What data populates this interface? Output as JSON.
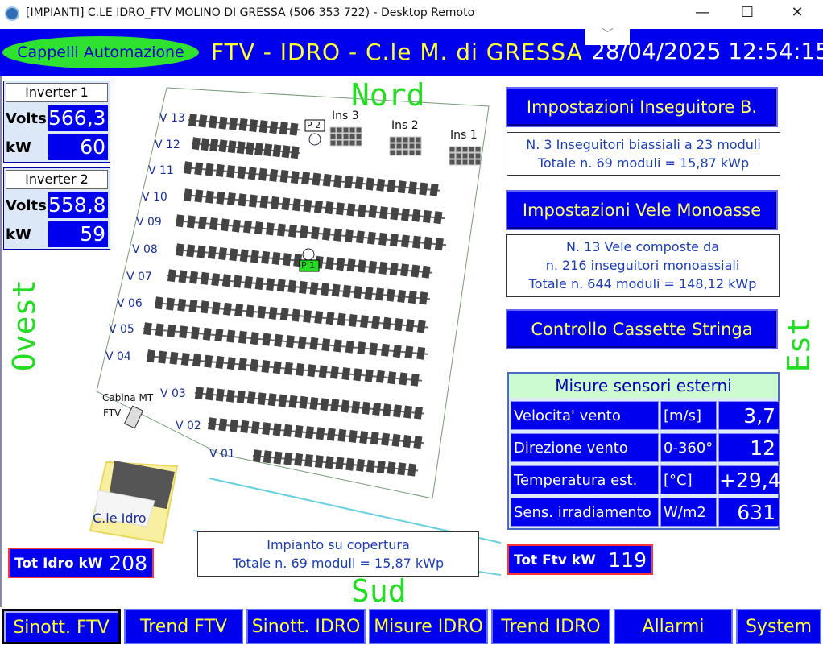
{
  "window": {
    "title": "[IMPIANTI] C.LE IDRO_FTV MOLINO DI GRESSA (506 353 722) - Desktop Remoto",
    "minimize": "—",
    "maximize": "☐",
    "close": "✕"
  },
  "header": {
    "brand": "Cappelli Automazione",
    "title": "FTV - IDRO - C.le M. di GRESSA",
    "datetime": "28/04/2025 12:54:15",
    "caret": "﹀"
  },
  "inverters": [
    {
      "title": "Inverter 1",
      "volts_label": "Volts",
      "volts": "566,3",
      "kw_label": "kW",
      "kw": "60"
    },
    {
      "title": "Inverter 2",
      "volts_label": "Volts",
      "volts": "558,8",
      "kw_label": "kW",
      "kw": "59"
    }
  ],
  "compass": {
    "north": "Nord",
    "south": "Sud",
    "west": "Ovest",
    "east": "Est"
  },
  "map": {
    "rows": [
      "V 13",
      "V 12",
      "V 11",
      "V 10",
      "V 09",
      "V 08",
      "V 07",
      "V 06",
      "V 05",
      "V 04",
      "V 03",
      "V 02",
      "V 01"
    ],
    "ins": [
      "Ins 3",
      "Ins 2",
      "Ins 1"
    ],
    "p1": "P 1",
    "p2": "P 2",
    "cabina": "Cabina MT",
    "cabina2": "FTV",
    "centrale": "C.le Idro"
  },
  "buttons": {
    "inseguitore": "Impostazioni Inseguitore B.",
    "vele": "Impostazioni Vele Monoasse",
    "cassette": "Controllo Cassette Stringa"
  },
  "info": {
    "biassiali_1": "N. 3 Inseguitori biassiali a 23 moduli",
    "biassiali_2": "Totale n. 69 moduli = 15,87 kWp",
    "vele_1": "N. 13 Vele composte da",
    "vele_2": "n. 216 inseguitori monoassiali",
    "vele_3": "Totale n. 644 moduli = 148,12 kWp",
    "copertura_1": "Impianto su copertura",
    "copertura_2": "Totale n. 69 moduli = 15,87 kWp"
  },
  "sensors": {
    "title": "Misure sensori esterni",
    "rows": [
      {
        "name": "Velocita' vento",
        "unit": "[m/s]",
        "value": "3,7"
      },
      {
        "name": "Direzione vento",
        "unit": "0-360°",
        "value": "12"
      },
      {
        "name": "Temperatura est.",
        "unit": "[°C]",
        "value": "+29,4"
      },
      {
        "name": "Sens. irradiamento",
        "unit": "W/m2",
        "value": "631"
      }
    ]
  },
  "totals": {
    "idro_label": "Tot Idro kW",
    "idro_value": "208",
    "ftv_label": "Tot Ftv kW",
    "ftv_value": "119"
  },
  "nav": [
    "Sinott. FTV",
    "Trend FTV",
    "Sinott. IDRO",
    "Misure IDRO",
    "Trend IDRO",
    "Allarmi",
    "System"
  ],
  "colors": {
    "panel_blue": "#0000ee",
    "label_yellow": "#ffff33",
    "compass_green": "#22dd22",
    "brand_green": "#2fe22f"
  }
}
